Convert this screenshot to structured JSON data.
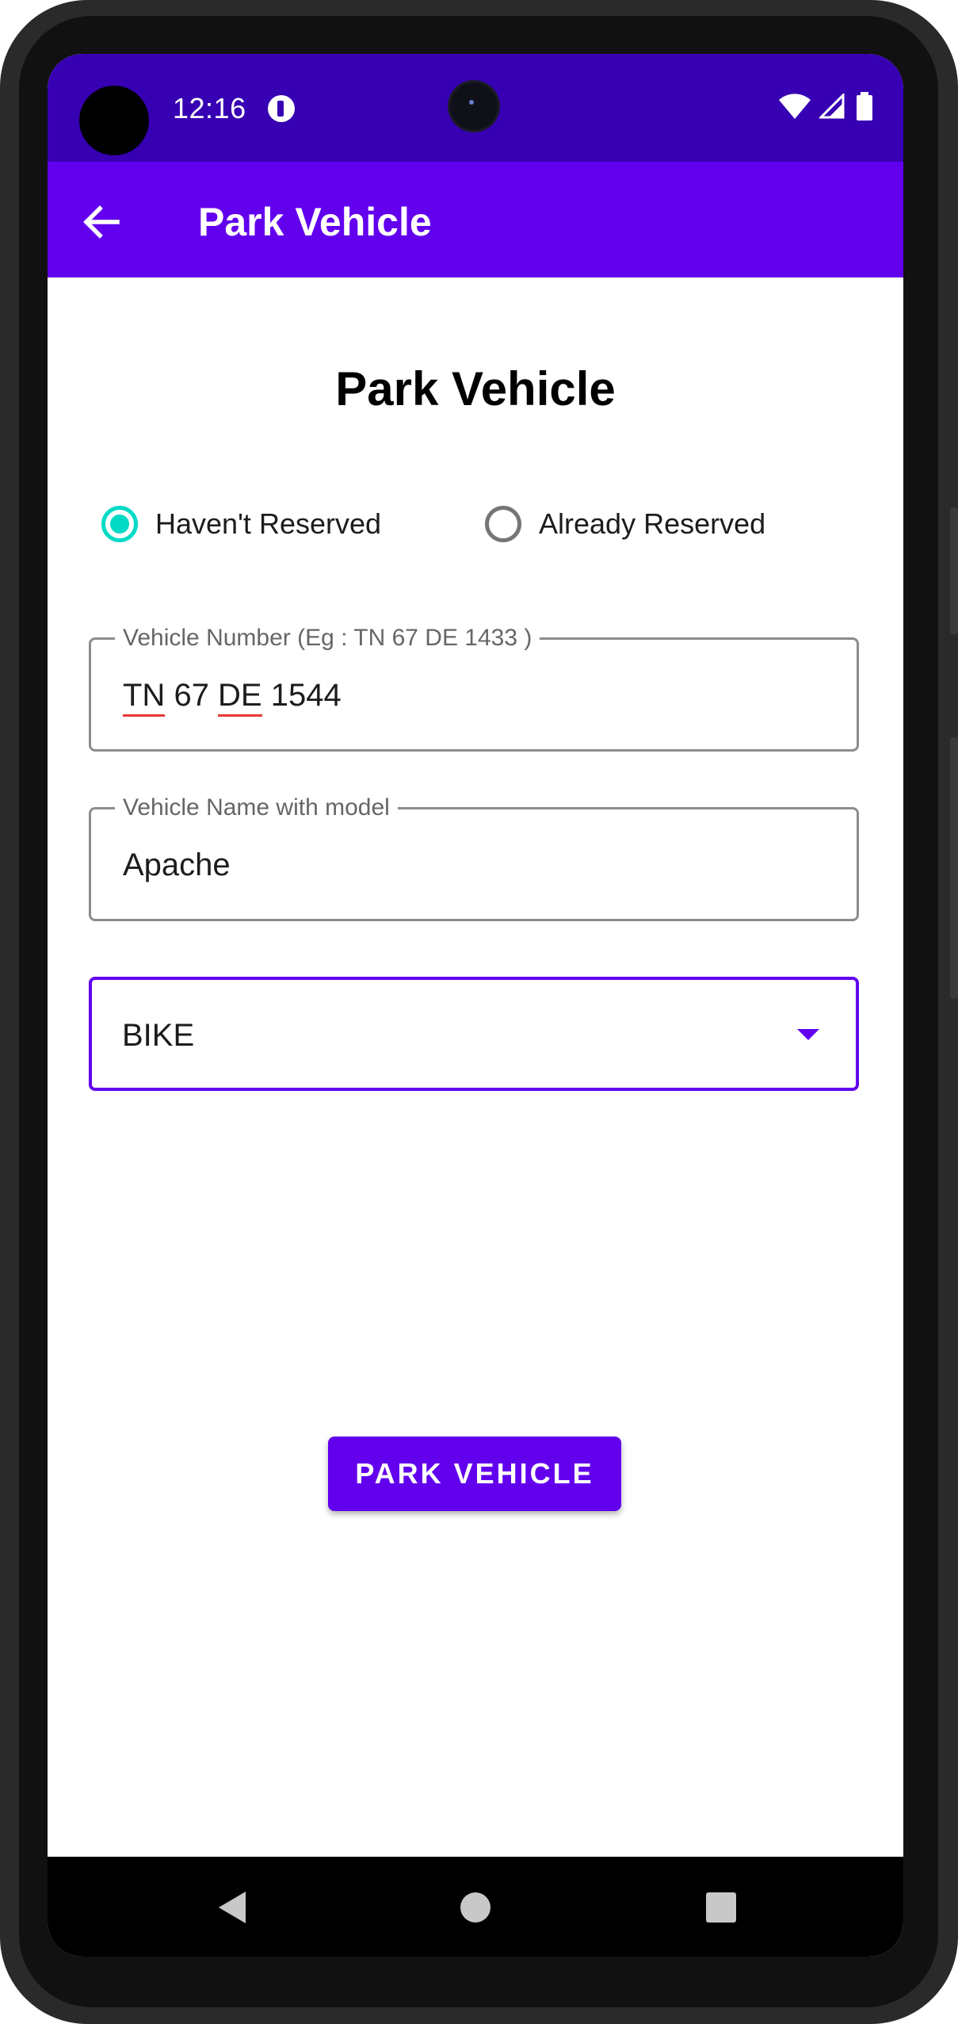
{
  "status_bar": {
    "time": "12:16",
    "icons": [
      "app-notification-icon",
      "wifi-icon",
      "cell-signal-icon",
      "battery-icon"
    ]
  },
  "app_bar": {
    "title": "Park Vehicle",
    "back_icon": "arrow-back-icon",
    "background_color": "#6200ee"
  },
  "content": {
    "heading": "Park Vehicle",
    "reservation_options": [
      {
        "label": "Haven't Reserved",
        "checked": true
      },
      {
        "label": "Already Reserved",
        "checked": false
      }
    ],
    "vehicle_number": {
      "label": "Vehicle Number (Eg : TN 67 DE 1433 )",
      "value_parts": [
        "TN",
        " 67 ",
        "DE",
        " 1544"
      ]
    },
    "vehicle_name": {
      "label": "Vehicle Name with model",
      "value": "Apache"
    },
    "vehicle_type": {
      "selected": "BIKE"
    },
    "submit_label": "PARK VEHICLE"
  },
  "colors": {
    "primary": "#6200ee",
    "primary_dark": "#3700b3",
    "accent": "#03dac5"
  },
  "nav_bar": {
    "buttons": [
      "back-triangle-icon",
      "home-circle-icon",
      "recents-square-icon"
    ]
  }
}
